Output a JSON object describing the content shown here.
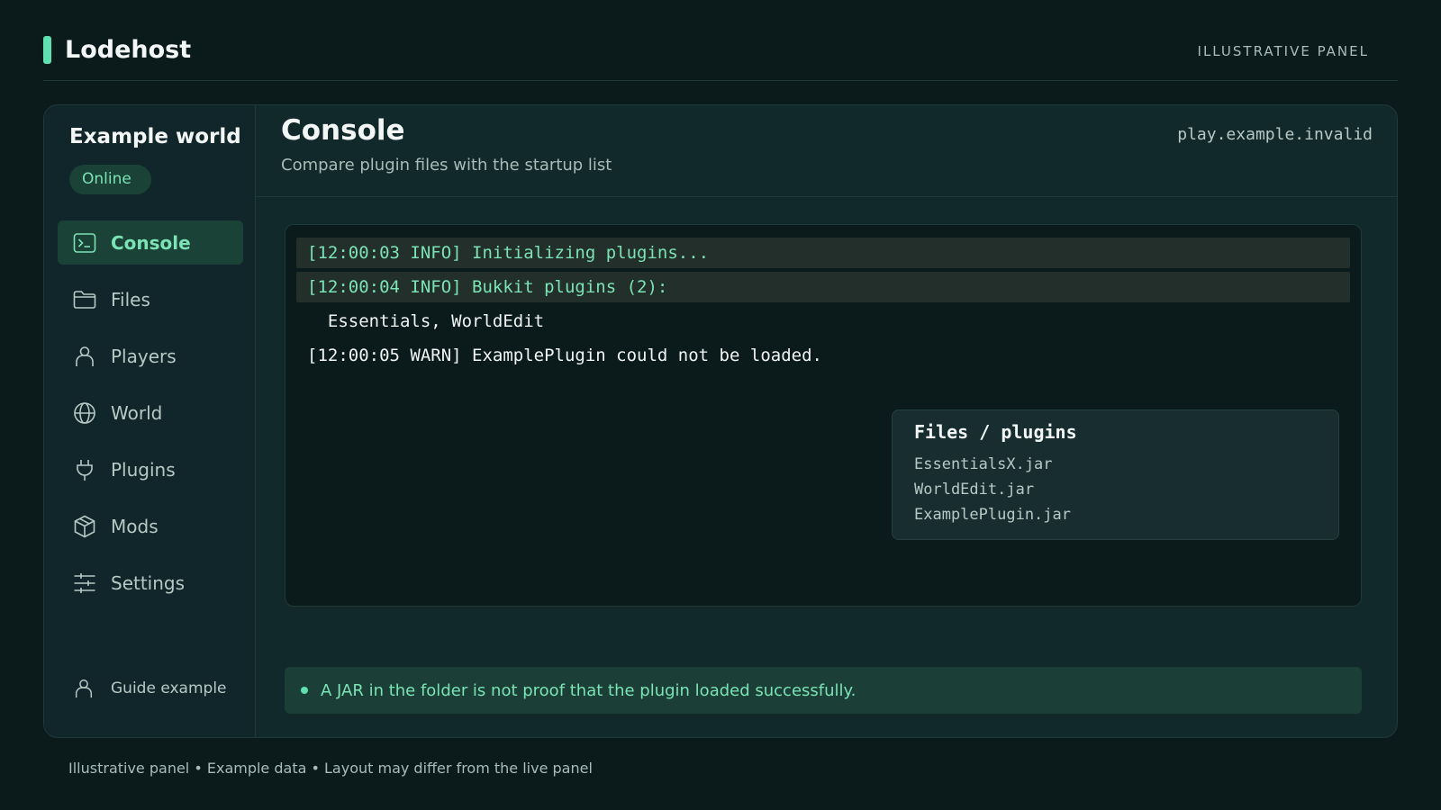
{
  "app": {
    "brand": "Lodehost",
    "panel_tag": "ILLUSTRATIVE PANEL",
    "accent": "#5fe0b0"
  },
  "sidebar": {
    "server_name": "Example world",
    "status": "Online",
    "items": [
      {
        "label": "Console",
        "icon": "terminal-icon",
        "active": true
      },
      {
        "label": "Files",
        "icon": "folder-icon"
      },
      {
        "label": "Players",
        "icon": "user-icon"
      },
      {
        "label": "World",
        "icon": "globe-icon"
      },
      {
        "label": "Plugins",
        "icon": "plug-icon"
      },
      {
        "label": "Mods",
        "icon": "box-icon"
      },
      {
        "label": "Settings",
        "icon": "sliders-icon"
      }
    ],
    "guide": "Guide example"
  },
  "main": {
    "title": "Console",
    "subtitle": "Compare plugin files with the startup list",
    "host": "play.example.invalid"
  },
  "console": {
    "lines": [
      "[12:00:03 INFO] Initializing plugins...",
      "[12:00:04 INFO] Bukkit plugins (2):",
      "  Essentials, WorldEdit",
      "[12:00:05 WARN] ExamplePlugin could not be loaded."
    ]
  },
  "files_box": {
    "title": "Files / plugins",
    "files": [
      "EssentialsX.jar",
      "WorldEdit.jar",
      "ExamplePlugin.jar"
    ]
  },
  "notice": "A JAR in the folder is not proof that the plugin loaded successfully.",
  "footer": "Illustrative panel • Example data • Layout may differ from the live panel"
}
